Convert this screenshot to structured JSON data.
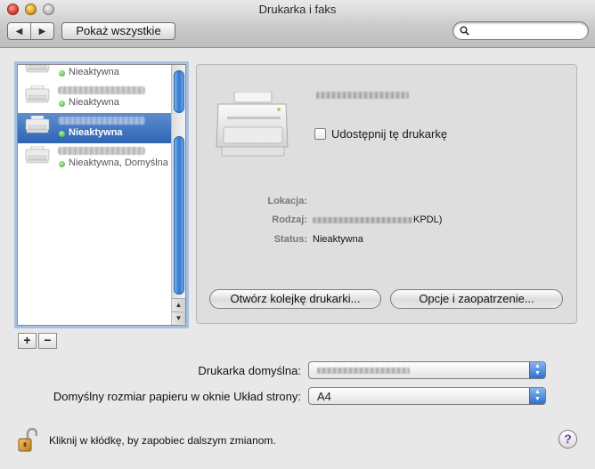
{
  "window": {
    "title": "Drukarka i faks"
  },
  "toolbar": {
    "back_glyph": "◀",
    "forward_glyph": "▶",
    "show_all_label": "Pokaż wszystkie",
    "search_placeholder": ""
  },
  "printers": [
    {
      "status": "Nieaktywna",
      "selected": false
    },
    {
      "status": "Nieaktywna",
      "selected": false
    },
    {
      "status": "Nieaktywna",
      "selected": true
    },
    {
      "status": "Nieaktywna, Domyślna",
      "selected": false
    }
  ],
  "list_controls": {
    "add_label": "+",
    "remove_label": "−"
  },
  "detail": {
    "share_label": "Udostępnij tę drukarkę",
    "location_label": "Lokacja:",
    "location_value": "",
    "kind_label": "Rodzaj:",
    "kind_value_suffix": "KPDL)",
    "status_label": "Status:",
    "status_value": "Nieaktywna",
    "open_queue_button": "Otwórz kolejkę drukarki...",
    "options_button": "Opcje i zaopatrzenie..."
  },
  "defaults": {
    "default_printer_label": "Drukarka domyślna:",
    "paper_size_label": "Domyślny rozmiar papieru w oknie Układ strony:",
    "paper_size_value": "A4"
  },
  "footer": {
    "lock_text": "Kliknij w kłódkę, by zapobiec dalszym zmianom.",
    "help_label": "?"
  },
  "colors": {
    "selection": "#2f64b4",
    "status_dot": "#3aa82a",
    "scroll_thumb": "#2f78d2"
  }
}
